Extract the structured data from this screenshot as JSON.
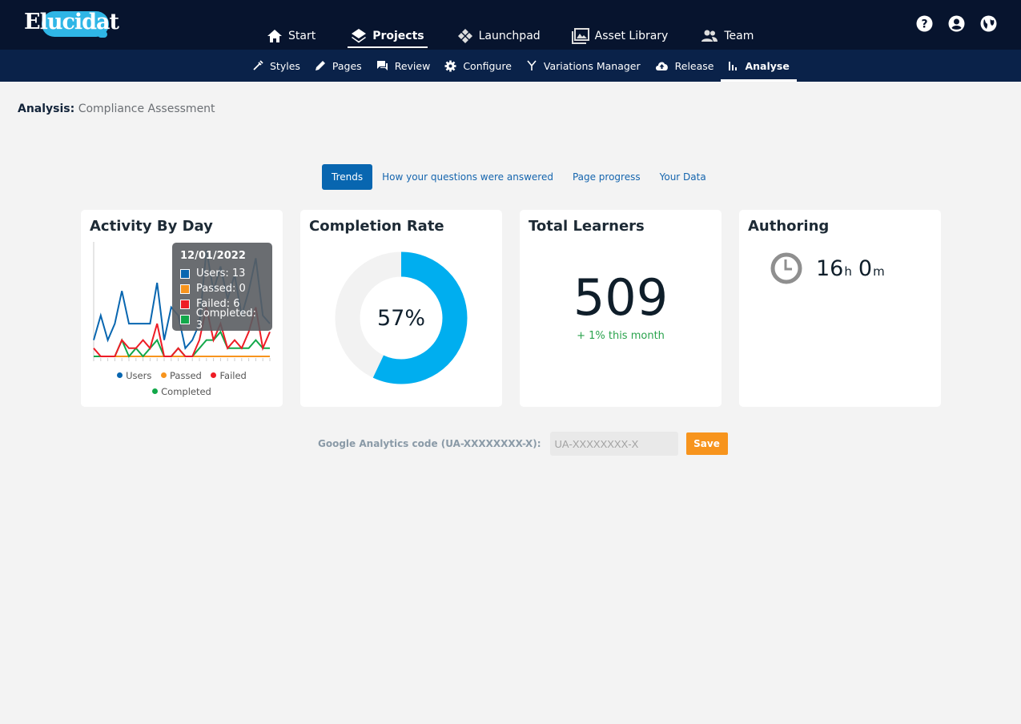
{
  "brand": {
    "name": "Elucidat",
    "logo_color": "#2fb6e6"
  },
  "main_nav": [
    {
      "label": "Start",
      "icon": "home-icon"
    },
    {
      "label": "Projects",
      "icon": "layers-icon",
      "active": true
    },
    {
      "label": "Launchpad",
      "icon": "launchpad-icon"
    },
    {
      "label": "Asset Library",
      "icon": "image-library-icon"
    },
    {
      "label": "Team",
      "icon": "team-icon"
    }
  ],
  "top_icons": [
    "help-icon",
    "account-icon",
    "globe-icon"
  ],
  "sub_nav": [
    {
      "label": "Styles",
      "icon": "eyedropper-icon"
    },
    {
      "label": "Pages",
      "icon": "pencil-icon"
    },
    {
      "label": "Review",
      "icon": "comment-icon"
    },
    {
      "label": "Configure",
      "icon": "gear-icon"
    },
    {
      "label": "Variations Manager",
      "icon": "branch-icon"
    },
    {
      "label": "Release",
      "icon": "cloud-upload-icon"
    },
    {
      "label": "Analyse",
      "icon": "bar-chart-icon",
      "active": true
    }
  ],
  "page": {
    "label": "Analysis:",
    "name": "Compliance Assessment"
  },
  "tabs": [
    {
      "label": "Trends",
      "active": true
    },
    {
      "label": "How your questions were answered"
    },
    {
      "label": "Page progress"
    },
    {
      "label": "Your Data"
    }
  ],
  "cards": {
    "activity": {
      "title": "Activity By Day"
    },
    "completion": {
      "title": "Completion Rate",
      "value_label": "57%",
      "percent": 57,
      "color": "#00aeef",
      "track_color": "#f2f2f2"
    },
    "learners": {
      "title": "Total Learners",
      "value": "509",
      "trend": "+ 1% this month"
    },
    "authoring": {
      "title": "Authoring",
      "hours": "16",
      "hours_unit": "h",
      "minutes": "0",
      "minutes_unit": "m"
    }
  },
  "tooltip": {
    "date": "12/01/2022",
    "rows": [
      {
        "label": "Users: 13",
        "color": "#0866b0"
      },
      {
        "label": "Passed: 0",
        "color": "#f7941d"
      },
      {
        "label": "Failed: 6",
        "color": "#ee1c25"
      },
      {
        "label": "Completed: 3",
        "color": "#12a84a"
      }
    ]
  },
  "chart_data": {
    "type": "line",
    "title": "Activity By Day",
    "xlabel": "",
    "ylabel": "",
    "ylim": [
      0,
      14
    ],
    "grid": false,
    "legend": "bottom",
    "x": [
      1,
      2,
      3,
      4,
      5,
      6,
      7,
      8,
      9,
      10,
      11,
      12,
      13,
      14,
      15,
      16,
      17,
      18,
      19,
      20,
      21,
      22,
      23,
      24,
      25,
      26
    ],
    "series": [
      {
        "name": "Users",
        "color": "#0866b0",
        "values": [
          2,
          5,
          2,
          4,
          8,
          4,
          4,
          4,
          4,
          9,
          2,
          6,
          5,
          1,
          2,
          4,
          13,
          8,
          11,
          7,
          10,
          5,
          8,
          12,
          5,
          4
        ]
      },
      {
        "name": "Passed",
        "color": "#f7941d",
        "values": [
          0,
          0,
          0,
          0,
          0,
          0,
          0,
          0,
          0,
          0,
          0,
          0,
          0,
          0,
          0,
          0,
          0,
          0,
          0,
          0,
          0,
          0,
          0,
          0,
          0,
          0
        ]
      },
      {
        "name": "Failed",
        "color": "#ee1c25",
        "values": [
          1,
          0,
          0,
          0,
          2,
          1,
          1,
          2,
          1,
          4,
          0,
          0,
          1,
          0,
          0,
          2,
          6,
          2,
          4,
          1,
          2,
          1,
          3,
          6,
          1,
          3
        ]
      },
      {
        "name": "Completed",
        "color": "#12a84a",
        "values": [
          0,
          0,
          0,
          0,
          2,
          0,
          1,
          0,
          1,
          2,
          0,
          0,
          1,
          0,
          0,
          1,
          2,
          2,
          3,
          1,
          1,
          1,
          1,
          2,
          1,
          1
        ]
      }
    ]
  },
  "analytics": {
    "label": "Google Analytics code (UA-XXXXXXXX-X):",
    "value": "",
    "placeholder": "UA-XXXXXXXX-X",
    "save_label": "Save",
    "save_color": "#f7941d"
  }
}
